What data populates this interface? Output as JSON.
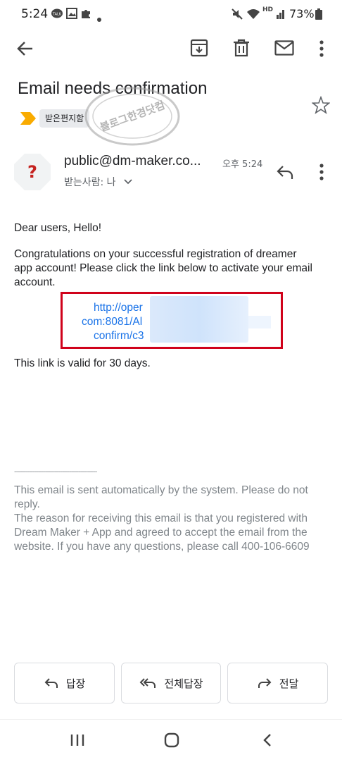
{
  "status_bar": {
    "time": "5:24",
    "battery": "73%",
    "hd_label": "HD"
  },
  "email": {
    "subject": "Email needs confirmation",
    "label": "받은편지함",
    "sender": "public@dm-maker.co...",
    "time": "오후 5:24",
    "recipient": "받는사람: 나",
    "greeting": "Dear users, Hello!",
    "paragraph": "Congratulations on your successful registration of dreamer app account! Please click the link below to activate your email account.",
    "link_lines": [
      "http://oper",
      "com:8081/Al",
      "confirm/c3"
    ],
    "validity": "This link is valid for 30 days.",
    "divider": "---------------------------------------------",
    "footer_1": "This email is sent automatically by the system. Please do not reply.",
    "footer_2": "The reason for receiving this email is that you registered with Dream Maker + App and agreed to accept the email from the website. If you have any questions, please call 400-106-6609"
  },
  "watermark": {
    "text": "블로그한경닷컴"
  },
  "actions": {
    "reply": "답장",
    "reply_all": "전체답장",
    "forward": "전달"
  },
  "colors": {
    "label_arrow": "#f9ab00",
    "highlight_box": "#d0021b",
    "link": "#1a73e8"
  }
}
